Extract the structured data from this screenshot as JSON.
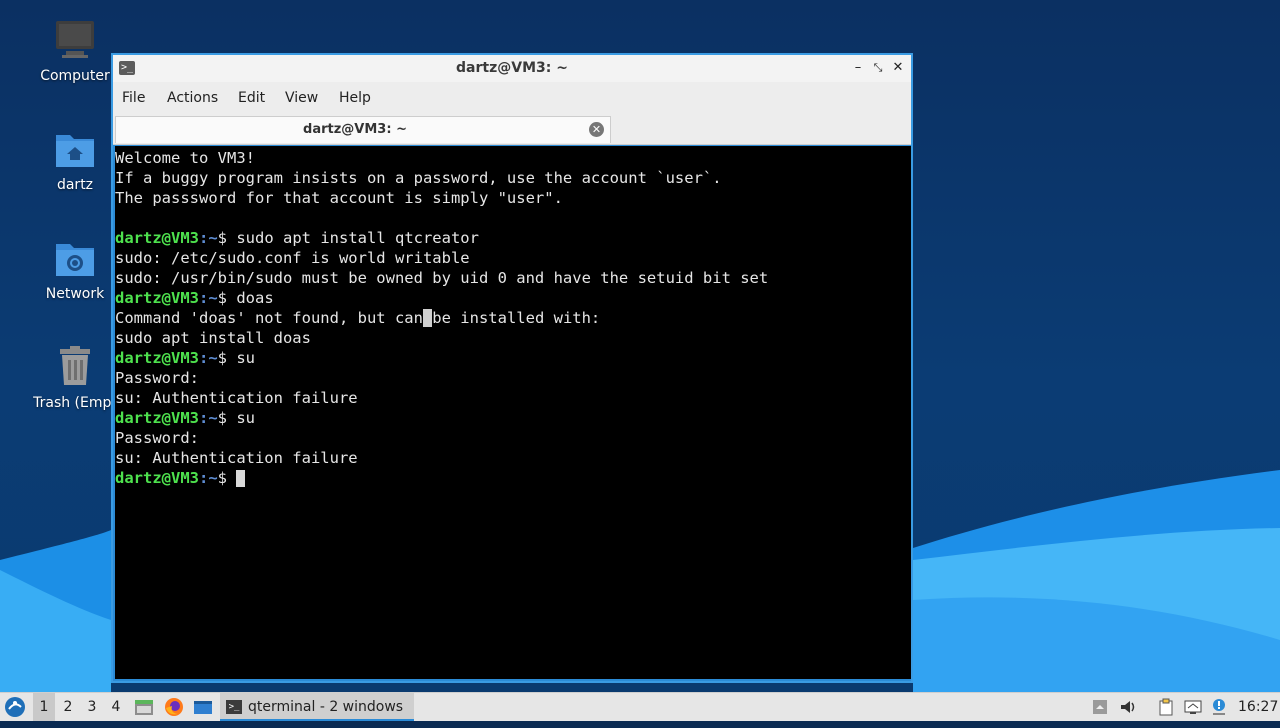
{
  "desktop": {
    "icons": [
      {
        "label": "Computer",
        "icon": "computer-icon"
      },
      {
        "label": "dartz",
        "icon": "home-folder-icon"
      },
      {
        "label": "Network",
        "icon": "network-folder-icon"
      },
      {
        "label": "Trash (Empt",
        "icon": "trash-icon"
      }
    ]
  },
  "window": {
    "title": "dartz@VM3: ~",
    "menus": [
      "File",
      "Actions",
      "Edit",
      "View",
      "Help"
    ],
    "tab_label": "dartz@VM3: ~"
  },
  "terminal": {
    "prompt_user": "dartz@VM3",
    "prompt_path": ":~",
    "prompt_symbol": "$ ",
    "lines": [
      {
        "text": "Welcome to VM3!"
      },
      {
        "text": "If a buggy program insists on a password, use the account `user`."
      },
      {
        "text": "The passsword for that account is simply \"user\"."
      },
      {
        "text": ""
      },
      {
        "prompt": true,
        "text": "sudo apt install qtcreator"
      },
      {
        "text": "sudo: /etc/sudo.conf is world writable"
      },
      {
        "text": "sudo: /usr/bin/sudo must be owned by uid 0 and have the setuid bit set"
      },
      {
        "prompt": true,
        "text": "doas"
      },
      {
        "text": "Command 'doas' not found, but can be installed with:",
        "cursor_index": 33
      },
      {
        "text": "sudo apt install doas"
      },
      {
        "prompt": true,
        "text": "su"
      },
      {
        "text": "Password:"
      },
      {
        "text": "su: Authentication failure"
      },
      {
        "prompt": true,
        "text": "su"
      },
      {
        "text": "Password:"
      },
      {
        "text": "su: Authentication failure"
      },
      {
        "prompt": true,
        "text": "",
        "cursor": true
      }
    ]
  },
  "taskbar": {
    "workspaces": [
      "1",
      "2",
      "3",
      "4"
    ],
    "active_workspace": "1",
    "task_label": "qterminal - 2 windows",
    "clock": "16:27"
  },
  "colors": {
    "accent": "#2b8bd6",
    "prompt_user": "#4ee24e",
    "prompt_path": "#5f8dd3",
    "terminal_bg": "#000000",
    "terminal_fg": "#e6e6e6"
  }
}
